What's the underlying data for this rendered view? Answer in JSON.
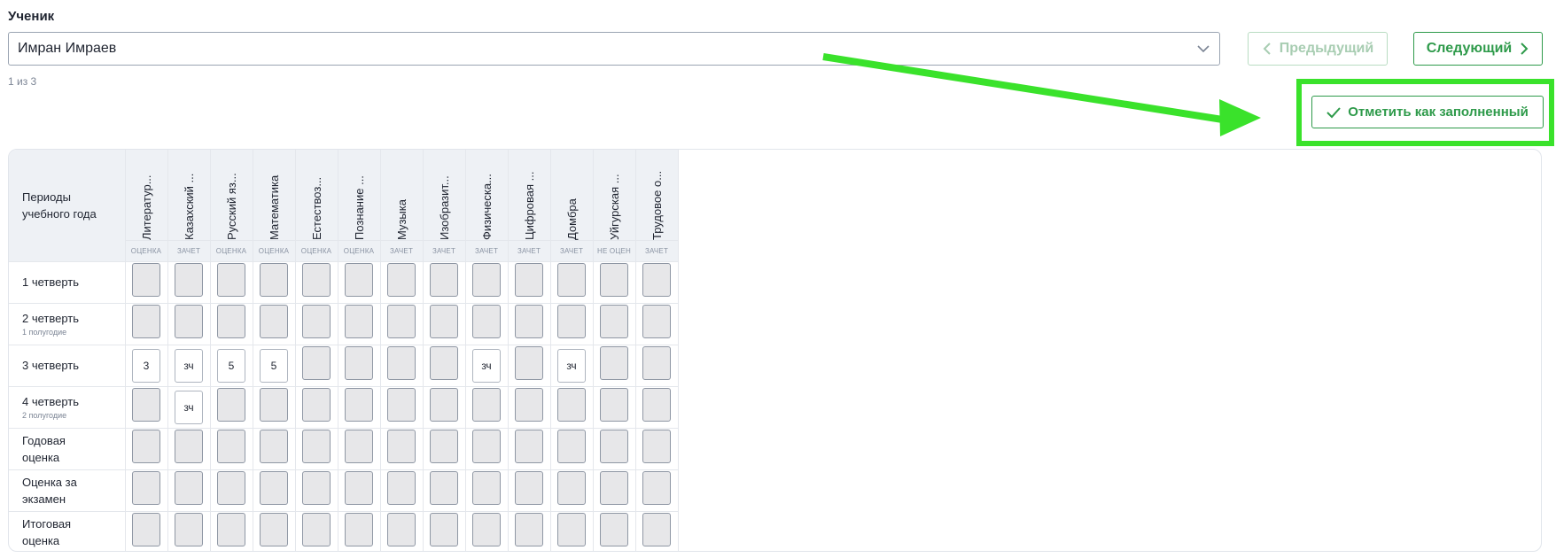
{
  "student": {
    "label": "Ученик",
    "selected": "Имран Имраев",
    "counter": "1 из 3"
  },
  "nav": {
    "prev_label": "Предыдущий",
    "next_label": "Следующий",
    "mark_label": "Отметить как заполненный"
  },
  "table": {
    "period_header": "Периоды учебного года",
    "subjects": [
      {
        "name": "Литератур...",
        "type": "ОЦЕНКА"
      },
      {
        "name": "Казахский ...",
        "type": "ЗАЧЕТ"
      },
      {
        "name": "Русский яз...",
        "type": "ОЦЕНКА"
      },
      {
        "name": "Математика",
        "type": "ОЦЕНКА"
      },
      {
        "name": "Естествоз...",
        "type": "ОЦЕНКА"
      },
      {
        "name": "Познание ...",
        "type": "ОЦЕНКА"
      },
      {
        "name": "Музыка",
        "type": "ЗАЧЕТ"
      },
      {
        "name": "Изобразит...",
        "type": "ЗАЧЕТ"
      },
      {
        "name": "Физическа...",
        "type": "ЗАЧЕТ"
      },
      {
        "name": "Цифровая ...",
        "type": "ЗАЧЕТ"
      },
      {
        "name": "Домбра",
        "type": "ЗАЧЕТ"
      },
      {
        "name": "Уйгурская ...",
        "type": "НЕ ОЦЕН"
      },
      {
        "name": "Трудовое о...",
        "type": "ЗАЧЕТ"
      }
    ],
    "periods": [
      {
        "name": "1 четверть",
        "sub": "",
        "grades": [
          "",
          "",
          "",
          "",
          "",
          "",
          "",
          "",
          "",
          "",
          "",
          "",
          ""
        ]
      },
      {
        "name": "2 четверть",
        "sub": "1 полугодие",
        "grades": [
          "",
          "",
          "",
          "",
          "",
          "",
          "",
          "",
          "",
          "",
          "",
          "",
          ""
        ]
      },
      {
        "name": "3 четверть",
        "sub": "",
        "grades": [
          "3",
          "зч",
          "5",
          "5",
          "",
          "",
          "",
          "",
          "зч",
          "",
          "зч",
          "",
          ""
        ]
      },
      {
        "name": "4 четверть",
        "sub": "2 полугодие",
        "grades": [
          "",
          "зч",
          "",
          "",
          "",
          "",
          "",
          "",
          "",
          "",
          "",
          "",
          ""
        ]
      },
      {
        "name": "Годовая оценка",
        "sub": "",
        "grades": [
          "",
          "",
          "",
          "",
          "",
          "",
          "",
          "",
          "",
          "",
          "",
          "",
          ""
        ]
      },
      {
        "name": "Оценка за экзамен",
        "sub": "",
        "grades": [
          "",
          "",
          "",
          "",
          "",
          "",
          "",
          "",
          "",
          "",
          "",
          "",
          ""
        ]
      },
      {
        "name": "Итоговая оценка",
        "sub": "",
        "grades": [
          "",
          "",
          "",
          "",
          "",
          "",
          "",
          "",
          "",
          "",
          "",
          "",
          ""
        ]
      }
    ]
  },
  "colors": {
    "accent_green": "#2e9a4a",
    "highlight_green": "#3ae22b"
  }
}
